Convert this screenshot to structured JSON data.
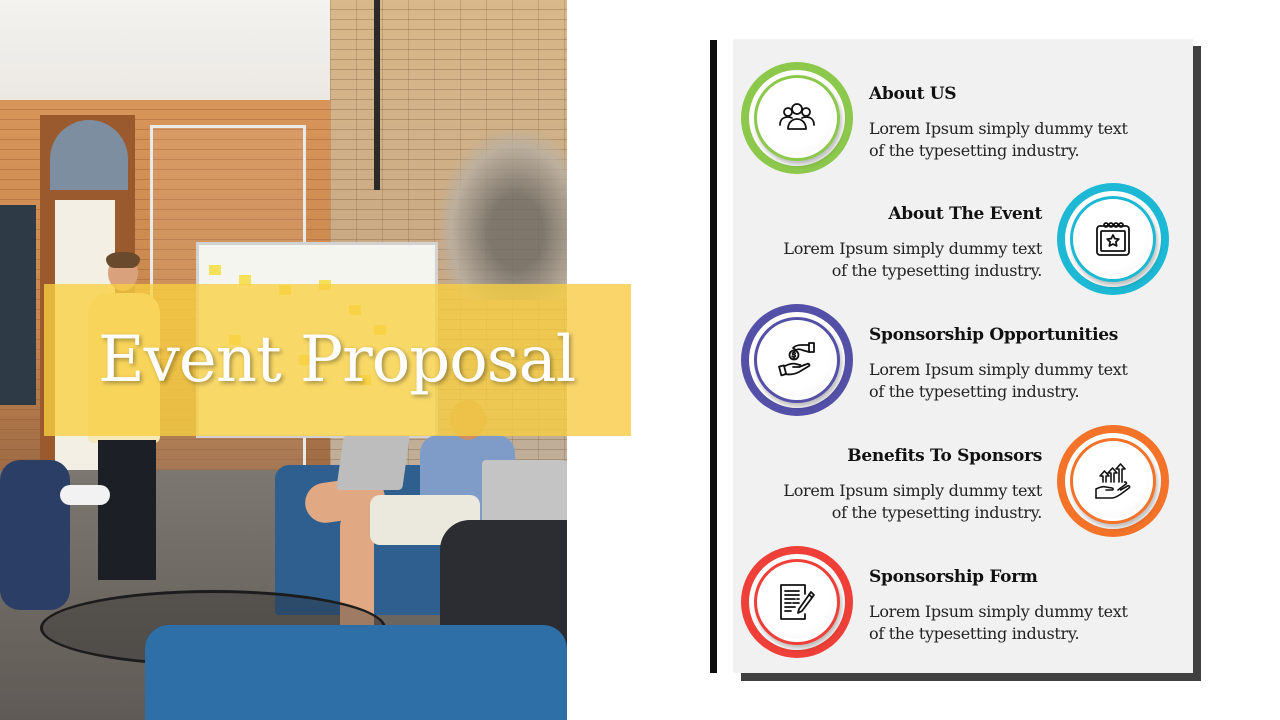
{
  "slide": {
    "title": "Event Proposal",
    "photo_description": "team meeting in brick-walled office with presenter at whiteboard",
    "accent_colors": {
      "banner": "#F8D040",
      "panel_background": "#F1F1F1",
      "panel_shadow": "#404040",
      "left_bar": "#0D0D0D"
    }
  },
  "items": [
    {
      "title": "About US",
      "description_line1": "Lorem Ipsum simply dummy text",
      "description_line2": "of the typesetting industry.",
      "icon": "people-group-icon",
      "color": "#8CC84B",
      "side": "left"
    },
    {
      "title": "About The Event",
      "description_line1": "Lorem Ipsum simply dummy text",
      "description_line2": "of the typesetting industry.",
      "icon": "calendar-star-icon",
      "color": "#1DB8D3",
      "side": "right"
    },
    {
      "title": "Sponsorship Opportunities",
      "description_line1": "Lorem Ipsum simply dummy text",
      "description_line2": "of the typesetting industry.",
      "icon": "hand-giving-money-icon",
      "color": "#5450A8",
      "side": "left"
    },
    {
      "title": "Benefits To Sponsors",
      "description_line1": "Lorem Ipsum simply dummy text",
      "description_line2": "of the typesetting industry.",
      "icon": "hand-growth-arrows-icon",
      "color": "#F47329",
      "side": "right"
    },
    {
      "title": "Sponsorship Form",
      "description_line1": "Lorem Ipsum simply dummy text",
      "description_line2": "of the typesetting industry.",
      "icon": "document-pen-icon",
      "color": "#EE4038",
      "side": "left"
    }
  ]
}
